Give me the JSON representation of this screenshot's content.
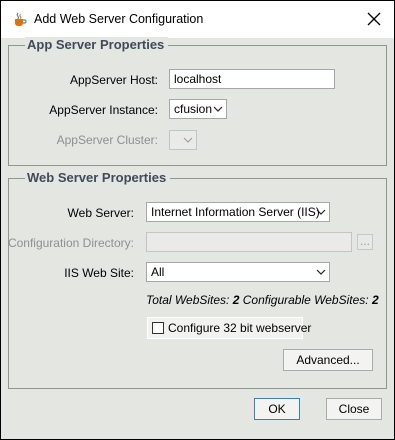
{
  "window": {
    "title": "Add Web Server Configuration"
  },
  "app_server": {
    "group_title": "App Server Properties",
    "host_label": "AppServer Host:",
    "host_value": "localhost",
    "instance_label": "AppServer Instance:",
    "instance_value": "cfusion",
    "cluster_label": "AppServer Cluster:",
    "cluster_value": ""
  },
  "web_server": {
    "group_title": "Web Server Properties",
    "web_server_label": "Web Server:",
    "web_server_value": "Internet Information Server (IIS)",
    "config_dir_label": "Configuration Directory:",
    "config_dir_value": "",
    "browse_label": "...",
    "iis_site_label": "IIS Web Site:",
    "iis_site_value": "All",
    "total_label": "Total WebSites:",
    "total_value": "2",
    "configurable_label": "Configurable WebSites:",
    "configurable_value": "2",
    "checkbox_label": "Configure 32 bit webserver",
    "checkbox_checked": false,
    "advanced_label": "Advanced..."
  },
  "footer": {
    "ok_label": "OK",
    "close_label": "Close"
  },
  "icons": {
    "app_icon": "java-coffee-cup-icon",
    "close": "close-icon",
    "dropdown": "chevron-down-icon"
  },
  "colors": {
    "group_title": "#3f4a5a",
    "window_bg": "#e3e6e1",
    "focus_border": "#3c7fb1"
  }
}
